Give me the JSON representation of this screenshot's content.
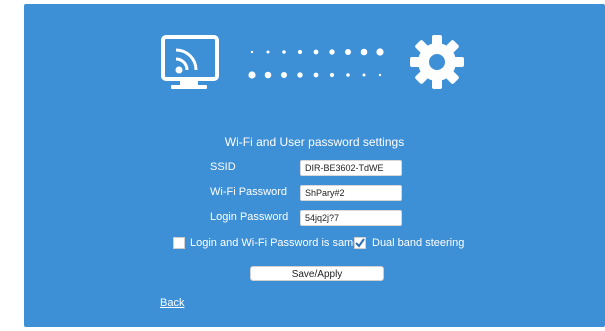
{
  "page": {
    "title": "Wi-Fi and User password settings"
  },
  "form": {
    "ssid": {
      "label": "SSID",
      "value": "DIR-BE3602-TdWE"
    },
    "wifi_password": {
      "label": "Wi-Fi Password",
      "value": "ShPary#2"
    },
    "login_password": {
      "label": "Login Password",
      "value": "54jq2j?7"
    }
  },
  "options": {
    "same_password": {
      "label": "Login and Wi-Fi Password is same",
      "checked": false
    },
    "dual_band": {
      "label": "Dual band steering",
      "checked": true
    }
  },
  "actions": {
    "save_label": "Save/Apply",
    "back_label": "Back"
  },
  "icons": {
    "left": "cast-screen-icon",
    "right": "gear-icon"
  },
  "colors": {
    "background": "#3d8fd6",
    "foreground": "#ffffff"
  }
}
